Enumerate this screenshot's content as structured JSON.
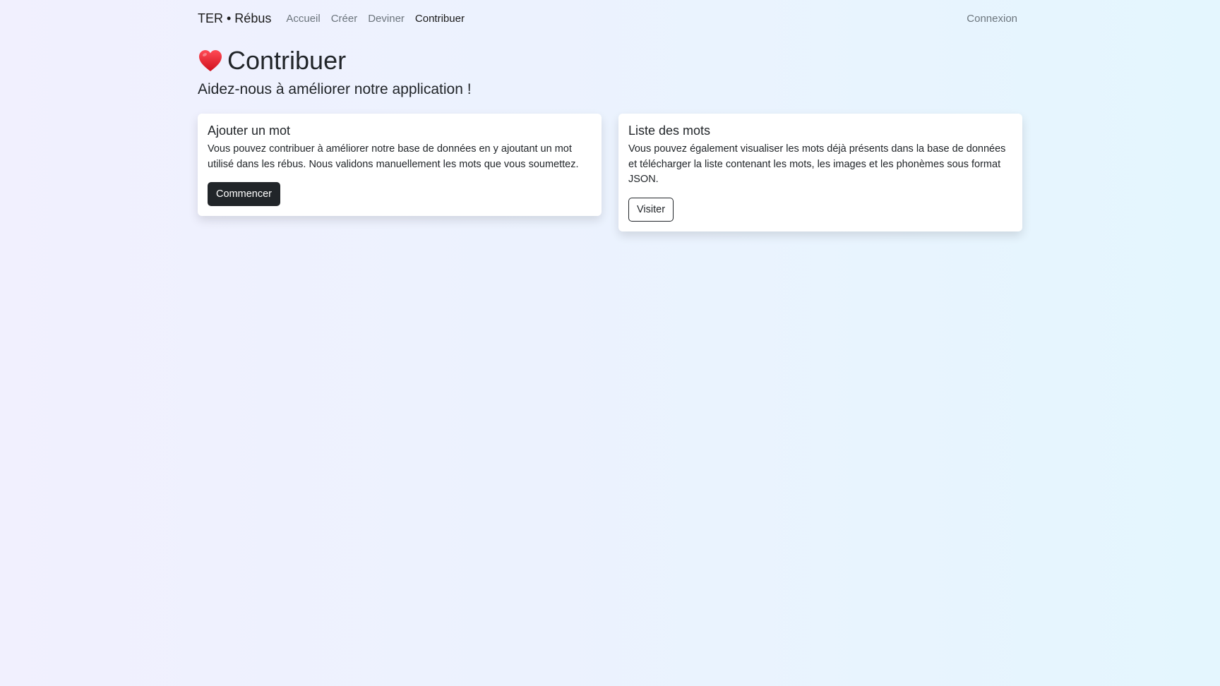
{
  "navbar": {
    "brand": "TER • Rébus",
    "links": [
      {
        "label": "Accueil"
      },
      {
        "label": "Créer"
      },
      {
        "label": "Deviner"
      },
      {
        "label": "Contribuer",
        "active": true
      }
    ],
    "login": "Connexion"
  },
  "header": {
    "icon": "heart-icon",
    "title": "Contribuer",
    "subtitle": "Aidez-nous à améliorer notre application !"
  },
  "cards": [
    {
      "title": "Ajouter un mot",
      "text": "Vous pouvez contribuer à améliorer notre base de données en y ajoutant un mot utilisé dans les rébus. Nous validons manuellement les mots que vous soumettez.",
      "button": "Commencer"
    },
    {
      "title": "Liste des mots",
      "text": "Vous pouvez également visualiser les mots déjà présents dans la base de données et télécharger la liste contenant les mots, les images et les phonèmes sous format JSON.",
      "button": "Visiter"
    }
  ],
  "colors": {
    "accent_dark": "#212529",
    "muted": "#6c757d",
    "heart": "#e0202e"
  }
}
